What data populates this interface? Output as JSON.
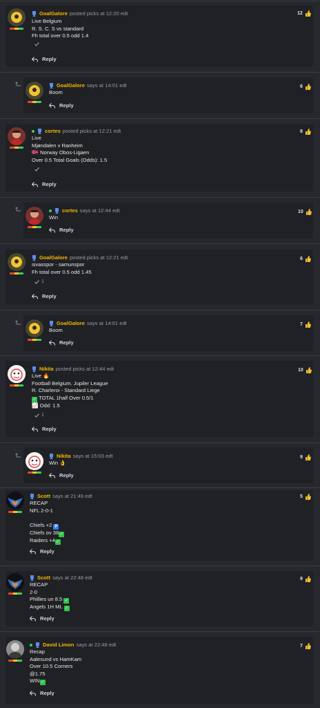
{
  "posts": [
    {
      "id": "p1",
      "user": "GoalGalore",
      "action": "posted picks at 12:20 edt",
      "likes": "12",
      "lines": [
        "Live Belgium",
        "R. S. C. S vs standard",
        "Fh total over 0.5 odd 1.4"
      ],
      "check": "",
      "reply": "Reply"
    },
    {
      "id": "p2",
      "user": "GoalGalore",
      "action": "says at 14:01 edt",
      "likes": "6",
      "lines": [
        "Boom"
      ],
      "reply": "Reply"
    },
    {
      "id": "p3",
      "user": "cortes",
      "action": "posted picks at 12:21 edt",
      "likes": "8",
      "lines": [
        "Live",
        "Mjøndalen v Ranheim",
        "Norway Obos-Ligaen",
        "Over 0.5 Total Goals (Odds): 1.5"
      ],
      "check": "",
      "reply": "Reply"
    },
    {
      "id": "p4",
      "user": "cortes",
      "action": "says at 12:44 edt",
      "likes": "10",
      "lines": [
        "Win"
      ],
      "reply": "Reply"
    },
    {
      "id": "p5",
      "user": "GoalGalore",
      "action": "posted picks at 12:21 edt",
      "likes": "6",
      "lines": [
        "sivasspor - samunspor",
        "Fh total over 0.5 odd 1.45"
      ],
      "check": "1",
      "reply": "Reply"
    },
    {
      "id": "p6",
      "user": "GoalGalore",
      "action": "says at 14:01 edt",
      "likes": "7",
      "lines": [
        "Boom"
      ],
      "reply": "Reply"
    },
    {
      "id": "p7",
      "user": "Nikita",
      "action": "posted picks at 12:44 edt",
      "likes": "10",
      "lines": [
        "Live 🔥",
        "Football Belgium. Jupiler League",
        "R. Charleroi - Standard Liege",
        "TOTAL 1half Over 0.5/1",
        "📈 Odd: 1.5"
      ],
      "check": "1",
      "reply": "Reply"
    },
    {
      "id": "p8",
      "user": "Nikita",
      "action": "says at 15:03 edt",
      "likes": "9",
      "lines": [
        "Win 👌"
      ],
      "reply": "Reply"
    },
    {
      "id": "p9",
      "user": "Scott",
      "action": "says at 21:49 edt",
      "likes": "5",
      "lines": [
        "RECAP",
        "NFL 2-0-1",
        "",
        "Chiefs +2",
        "Chiefs ov 38",
        "Raiders +4"
      ],
      "reply": "Reply"
    },
    {
      "id": "p10",
      "user": "Scott",
      "action": "says at 22:48 edt",
      "likes": "9",
      "lines": [
        "RECAP",
        "2-0",
        "Phillies un 8.5",
        "Angels 1H ML"
      ],
      "reply": "Reply"
    },
    {
      "id": "p11",
      "user": "David Limon",
      "action": "says at 22:48 edt",
      "likes": "7",
      "lines": [
        "Recap",
        "Aalesund vs HamKam",
        "Over 10.5 Corners",
        "@1.75",
        "WIN"
      ],
      "reply": "Reply"
    }
  ],
  "colors": {
    "username": "#f5b800",
    "online": "#3ecf5a",
    "check": "#33c24a"
  }
}
